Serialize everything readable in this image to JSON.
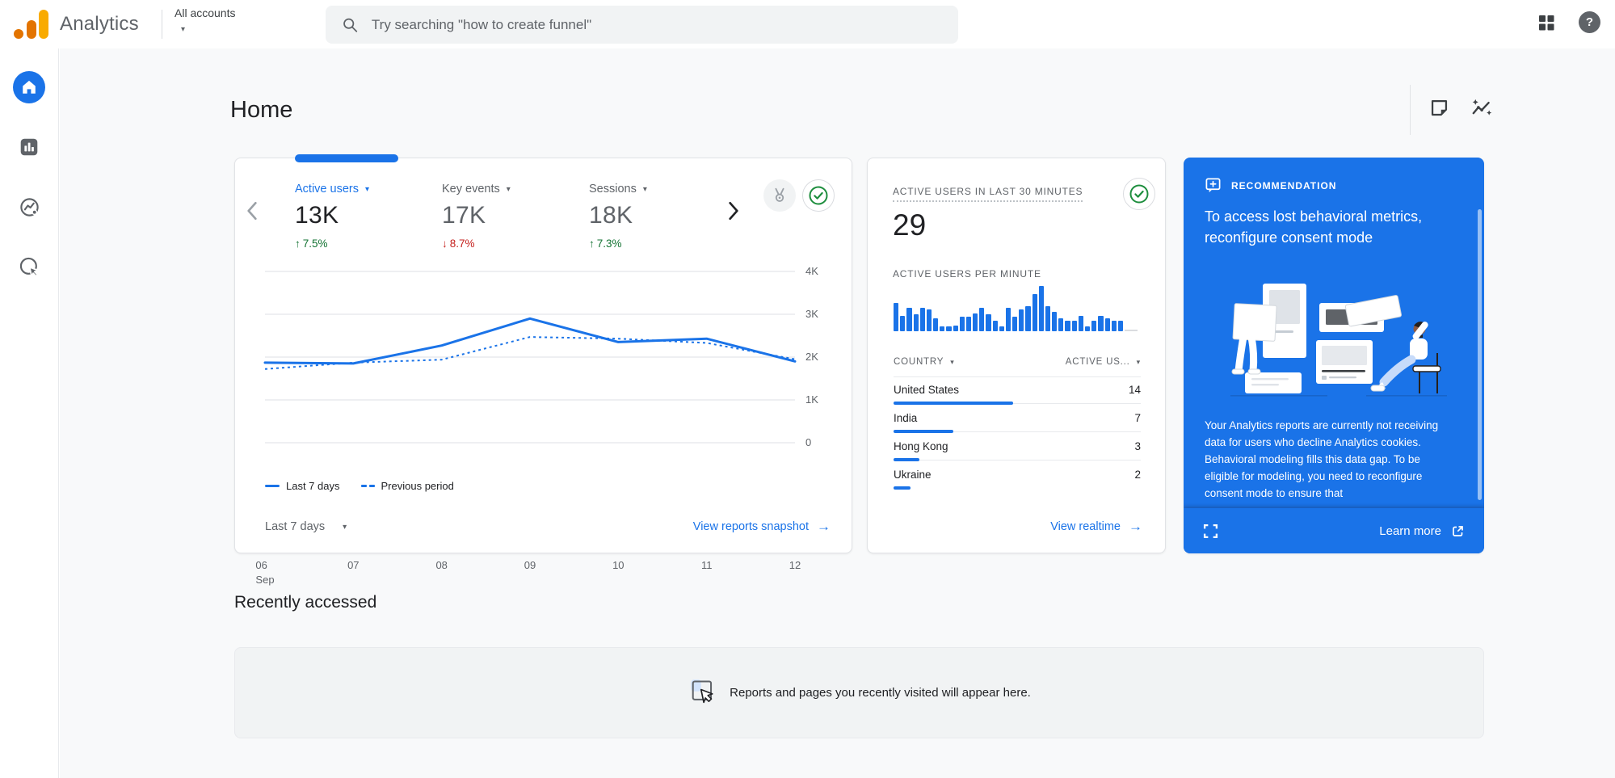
{
  "header": {
    "brand": "Analytics",
    "account_selector_label": "All accounts",
    "search_placeholder": "Try searching \"how to create funnel\""
  },
  "sidebar": {
    "items": [
      {
        "icon": "home-icon",
        "active": true
      },
      {
        "icon": "reports-icon",
        "active": false
      },
      {
        "icon": "explore-icon",
        "active": false
      },
      {
        "icon": "advertising-icon",
        "active": false
      }
    ]
  },
  "page": {
    "title": "Home"
  },
  "overview_card": {
    "metrics": [
      {
        "label": "Active users",
        "value": "13K",
        "delta": "7.5%",
        "direction": "up"
      },
      {
        "label": "Key events",
        "value": "17K",
        "delta": "8.7%",
        "direction": "down"
      },
      {
        "label": "Sessions",
        "value": "18K",
        "delta": "7.3%",
        "direction": "up"
      }
    ],
    "legend": [
      {
        "label": "Last 7 days",
        "style": "solid"
      },
      {
        "label": "Previous period",
        "style": "dashed"
      }
    ],
    "date_range_label": "Last 7 days",
    "footer_link": "View reports snapshot"
  },
  "realtime_card": {
    "title": "ACTIVE USERS IN LAST 30 MINUTES",
    "active_users": "29",
    "per_minute_label": "ACTIVE USERS PER MINUTE",
    "table": {
      "columns": [
        "COUNTRY",
        "ACTIVE US..."
      ],
      "total": 29,
      "rows": [
        {
          "country": "United States",
          "value": 14
        },
        {
          "country": "India",
          "value": 7
        },
        {
          "country": "Hong Kong",
          "value": 3
        },
        {
          "country": "Ukraine",
          "value": 2
        }
      ]
    },
    "footer_link": "View realtime"
  },
  "recommendation_card": {
    "badge": "RECOMMENDATION",
    "title": "To access lost behavioral metrics, reconfigure consent mode",
    "body": "Your Analytics reports are currently not receiving data for users who decline Analytics cookies. Behavioral modeling fills this data gap. To be eligible for modeling, you need to reconfigure consent mode to ensure that",
    "learn_more_label": "Learn more"
  },
  "recently_accessed": {
    "heading": "Recently accessed",
    "empty_message": "Reports and pages you recently visited will appear here."
  },
  "colors": {
    "accent_blue": "#1a73e8",
    "positive_green": "#137333",
    "negative_red": "#c5221f",
    "brand_amber": "#f9ab00",
    "brand_orange": "#e37400"
  },
  "chart_data": [
    {
      "type": "line",
      "title": "Active users trend — last 7 days vs previous period",
      "categories": [
        "06",
        "07",
        "08",
        "09",
        "10",
        "11",
        "12"
      ],
      "month_label": "Sep",
      "series": [
        {
          "name": "Last 7 days",
          "style": "solid",
          "values": [
            1870,
            1850,
            2270,
            2900,
            2350,
            2430,
            1900
          ]
        },
        {
          "name": "Previous period",
          "style": "dashed",
          "values": [
            1720,
            1870,
            1940,
            2470,
            2430,
            2330,
            1950
          ]
        }
      ],
      "ylim": [
        0,
        4000
      ],
      "yticks": [
        {
          "value": 4000,
          "label": "4K"
        },
        {
          "value": 3000,
          "label": "3K"
        },
        {
          "value": 2000,
          "label": "2K"
        },
        {
          "value": 1000,
          "label": "1K"
        },
        {
          "value": 0,
          "label": "0"
        }
      ],
      "grid": "horizontal",
      "legend_position": "bottom"
    },
    {
      "type": "bar",
      "title": "Active users per minute (last 30 minutes)",
      "values": [
        62,
        34,
        52,
        38,
        52,
        48,
        28,
        11,
        11,
        13,
        33,
        33,
        40,
        52,
        38,
        24,
        11,
        52,
        33,
        48,
        55,
        82,
        100,
        55,
        43,
        28,
        24,
        24,
        34,
        11,
        24,
        34,
        28,
        24,
        23
      ],
      "ylim": [
        0,
        100
      ]
    }
  ]
}
